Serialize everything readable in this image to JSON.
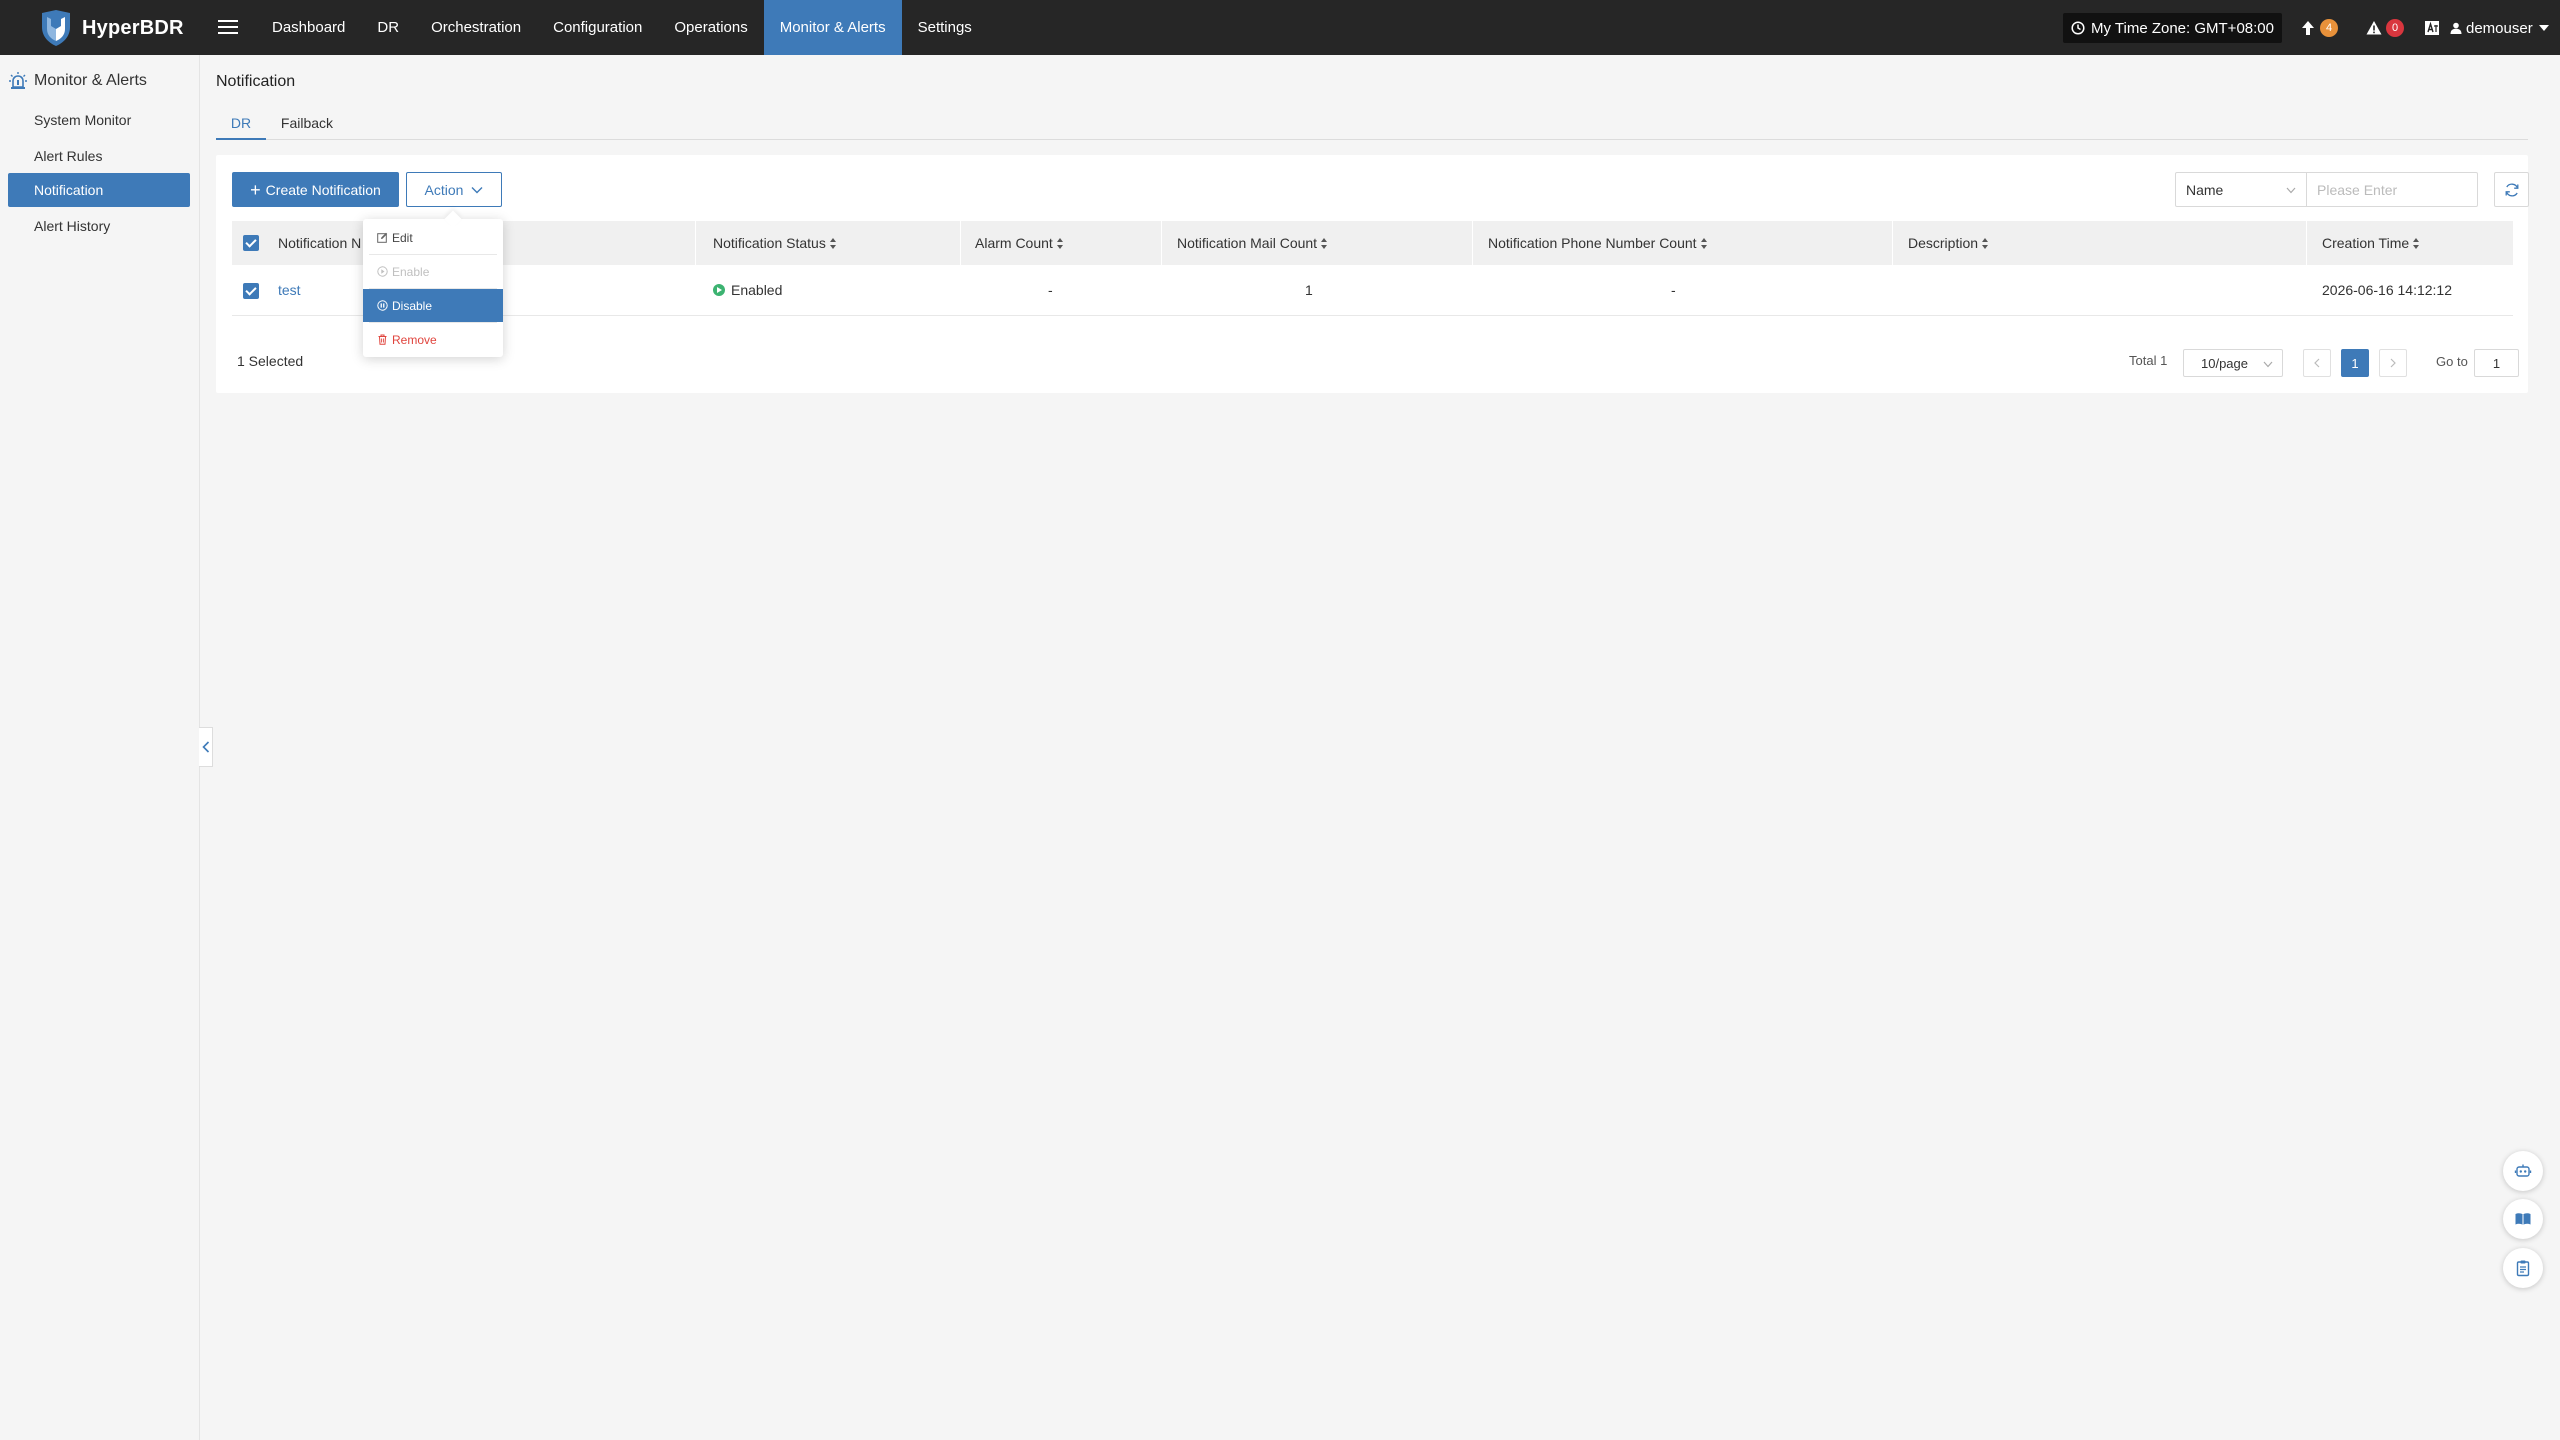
{
  "app": {
    "name": "HyperBDR"
  },
  "nav": {
    "items": [
      {
        "label": "Dashboard",
        "active": false
      },
      {
        "label": "DR",
        "active": false
      },
      {
        "label": "Orchestration",
        "active": false
      },
      {
        "label": "Configuration",
        "active": false
      },
      {
        "label": "Operations",
        "active": false
      },
      {
        "label": "Monitor & Alerts",
        "active": true
      },
      {
        "label": "Settings",
        "active": false
      }
    ]
  },
  "header": {
    "timezone": "My Time Zone: GMT+08:00",
    "upgrade_count": "4",
    "alert_count": "0",
    "user": "demouser"
  },
  "sidebar": {
    "heading": "Monitor & Alerts",
    "items": [
      {
        "label": "System Monitor",
        "active": false
      },
      {
        "label": "Alert Rules",
        "active": false
      },
      {
        "label": "Notification",
        "active": true
      },
      {
        "label": "Alert History",
        "active": false
      }
    ]
  },
  "page": {
    "title": "Notification",
    "tabs": [
      {
        "label": "DR",
        "active": true
      },
      {
        "label": "Failback",
        "active": false
      }
    ]
  },
  "toolbar": {
    "create_label": "Create Notification",
    "action_label": "Action",
    "search_field": "Name",
    "search_placeholder": "Please Enter"
  },
  "action_menu": {
    "items": [
      {
        "label": "Edit",
        "icon": "edit-icon",
        "state": "normal"
      },
      {
        "label": "Enable",
        "icon": "enable-icon",
        "state": "disabled"
      },
      {
        "label": "Disable",
        "icon": "disable-icon",
        "state": "active"
      },
      {
        "label": "Remove",
        "icon": "trash-icon",
        "state": "danger"
      }
    ]
  },
  "table": {
    "headers": {
      "name": "Notification N",
      "status": "Notification Status",
      "alarm": "Alarm Count",
      "mail": "Notification Mail Count",
      "phone": "Notification Phone Number Count",
      "description": "Description",
      "created": "Creation Time"
    },
    "rows": [
      {
        "name": "test",
        "status": "Enabled",
        "alarm": "-",
        "mail": "1",
        "phone": "-",
        "description": "",
        "created": "2026-06-16 14:12:12",
        "selected": true
      }
    ]
  },
  "footer": {
    "selected": "1 Selected",
    "total": "Total 1",
    "page_size": "10/page",
    "current_page": "1",
    "goto_label": "Go to",
    "goto_value": "1"
  },
  "colors": {
    "topbar": "#262626",
    "accent": "#3e7ab8",
    "success": "#3cb371",
    "danger": "#e0443d",
    "badge_orange": "#e8913a",
    "badge_red": "#d9363e"
  }
}
